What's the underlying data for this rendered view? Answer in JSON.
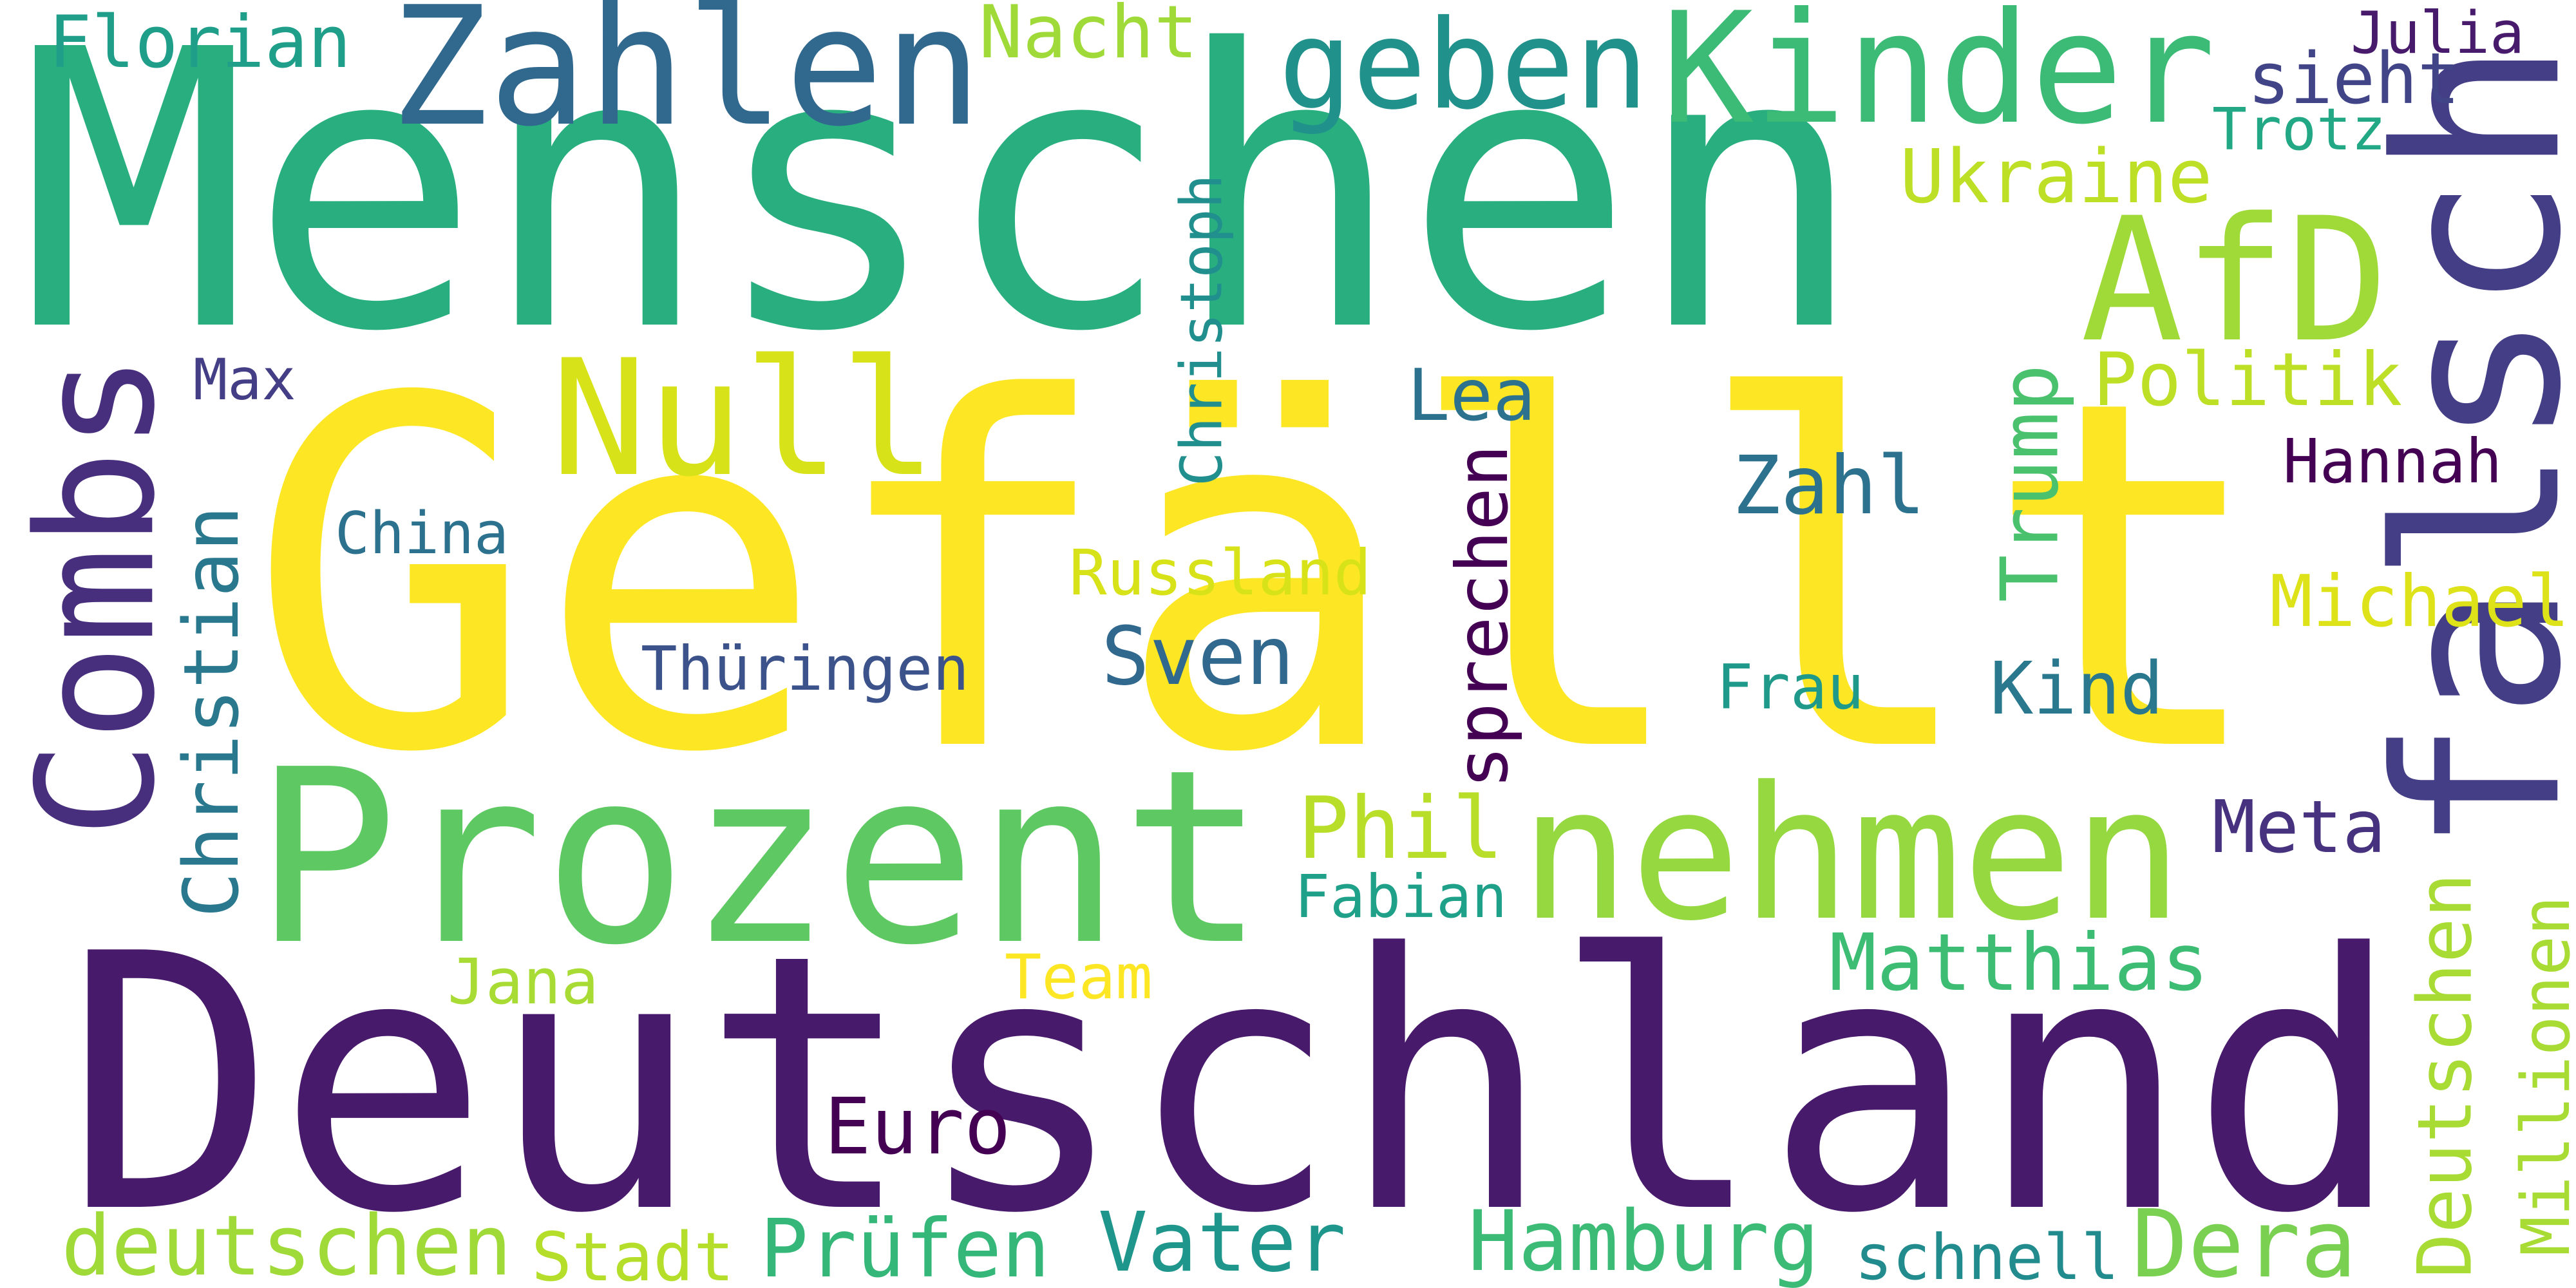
{
  "words": [
    {
      "text": "Gefällt",
      "color": "#fde725",
      "vertical": false
    },
    {
      "text": "Deutschland",
      "color": "#481a6c",
      "vertical": false
    },
    {
      "text": "Menschen",
      "color": "#29af7f",
      "vertical": false
    },
    {
      "text": "falsch",
      "color": "#433e85",
      "vertical": true
    },
    {
      "text": "Prozent",
      "color": "#5ec962",
      "vertical": false
    },
    {
      "text": "nehmen",
      "color": "#95d840",
      "vertical": false
    },
    {
      "text": "Kinder",
      "color": "#3bbb75",
      "vertical": false
    },
    {
      "text": "Zahlen",
      "color": "#31688e",
      "vertical": false
    },
    {
      "text": "geben",
      "color": "#21918c",
      "vertical": false
    },
    {
      "text": "Null",
      "color": "#d8e219",
      "vertical": false
    },
    {
      "text": "AfD",
      "color": "#a0da39",
      "vertical": false
    },
    {
      "text": "Combs",
      "color": "#472f7d",
      "vertical": true
    },
    {
      "text": "Florian",
      "color": "#1f9e89",
      "vertical": false
    },
    {
      "text": "Nacht",
      "color": "#a0da39",
      "vertical": false
    },
    {
      "text": "Julia",
      "color": "#481a6c",
      "vertical": false
    },
    {
      "text": "sieht",
      "color": "#414487",
      "vertical": false
    },
    {
      "text": "Trotz",
      "color": "#22a884",
      "vertical": false
    },
    {
      "text": "Ukraine",
      "color": "#bddf26",
      "vertical": false
    },
    {
      "text": "Christoph",
      "color": "#218f8d",
      "vertical": true
    },
    {
      "text": "Max",
      "color": "#433e85",
      "vertical": false
    },
    {
      "text": "Lea",
      "color": "#2c728e",
      "vertical": false
    },
    {
      "text": "Politik",
      "color": "#bddf26",
      "vertical": false
    },
    {
      "text": "Trump",
      "color": "#4ac16d",
      "vertical": true
    },
    {
      "text": "Zahl",
      "color": "#2c728e",
      "vertical": false
    },
    {
      "text": "Hannah",
      "color": "#440154",
      "vertical": false
    },
    {
      "text": "China",
      "color": "#2c728e",
      "vertical": false
    },
    {
      "text": "Christian",
      "color": "#2a788e",
      "vertical": true
    },
    {
      "text": "Russland",
      "color": "#d8e219",
      "vertical": false
    },
    {
      "text": "sprechen",
      "color": "#440154",
      "vertical": true
    },
    {
      "text": "Michael",
      "color": "#dde318",
      "vertical": false
    },
    {
      "text": "Thüringen",
      "color": "#3b528b",
      "vertical": false
    },
    {
      "text": "Sven",
      "color": "#31688e",
      "vertical": false
    },
    {
      "text": "Frau",
      "color": "#1f9a8a",
      "vertical": false
    },
    {
      "text": "Kind",
      "color": "#2a788e",
      "vertical": false
    },
    {
      "text": "Phil",
      "color": "#b8de29",
      "vertical": false
    },
    {
      "text": "Meta",
      "color": "#46327e",
      "vertical": false
    },
    {
      "text": "Fabian",
      "color": "#1fa088",
      "vertical": false
    },
    {
      "text": "Jana",
      "color": "#a8db34",
      "vertical": false
    },
    {
      "text": "Team",
      "color": "#fde725",
      "vertical": false
    },
    {
      "text": "Matthias",
      "color": "#3dbc74",
      "vertical": false
    },
    {
      "text": "Deutschen",
      "color": "#a8db34",
      "vertical": true
    },
    {
      "text": "Millionen",
      "color": "#a8db34",
      "vertical": true
    },
    {
      "text": "Euro",
      "color": "#440154",
      "vertical": false
    },
    {
      "text": "deutschen",
      "color": "#a0da39",
      "vertical": false
    },
    {
      "text": "Stadt",
      "color": "#b5de2b",
      "vertical": false
    },
    {
      "text": "Prüfen",
      "color": "#35b779",
      "vertical": false
    },
    {
      "text": "Vater",
      "color": "#1f968b",
      "vertical": false
    },
    {
      "text": "Hamburg",
      "color": "#3bbb75",
      "vertical": false
    },
    {
      "text": "schnell",
      "color": "#228b8d",
      "vertical": false
    },
    {
      "text": "Dera",
      "color": "#7ad151",
      "vertical": false
    }
  ]
}
